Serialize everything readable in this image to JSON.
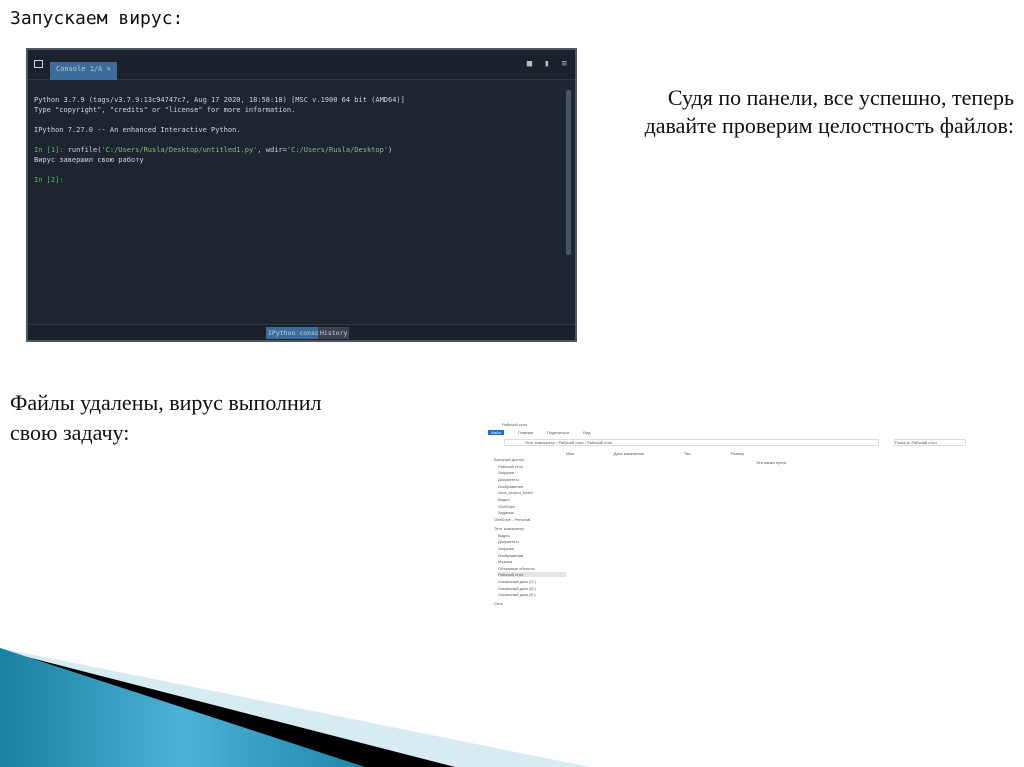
{
  "slide": {
    "title": "Запускаем вирус:",
    "right_text": [
      "Судя по панели, все успешно, теперь",
      "давайте проверим целостность файлов:"
    ],
    "left_text": [
      "Файлы удалены, вирус выполнил",
      "свою задачу:"
    ]
  },
  "console": {
    "tab": "Console 1/A ×",
    "lines": [
      "Python 3.7.9 (tags/v3.7.9:13c94747c7, Aug 17 2020, 18:58:18) [MSC v.1900 64 bit (AMD64)]",
      "Type \"copyright\", \"credits\" or \"license\" for more information.",
      "",
      "IPython 7.27.0 -- An enhanced Interactive Python."
    ],
    "prompt1": "In [1]: ",
    "cmd_pre": "runfile(",
    "cmd_path1": "'C:/Users/Rusla/Desktop/untitled1.py'",
    "cmd_mid": ", wdir=",
    "cmd_path2": "'C:/Users/Rusla/Desktop'",
    "cmd_end": ")",
    "output": "Вирус завершил свою работу",
    "prompt2": "In [2]:",
    "bottom_tabs": [
      "IPython console",
      "History"
    ]
  },
  "explorer": {
    "title": "Рабочий стол",
    "ribbon": [
      "Файл",
      "Главная",
      "Поделиться",
      "Вид"
    ],
    "address": "Этот компьютер › Рабочий стол › Рабочий стол",
    "search": "Поиск в: Рабочий стол",
    "columns": [
      "Имя",
      "Дата изменения",
      "Тип",
      "Размер"
    ],
    "empty": "Эта папка пуста.",
    "nav": [
      "Быстрый доступ",
      "Рабочий стол",
      "Загрузки",
      "Документы",
      "Изображения",
      "virus_project_folder",
      "Видео",
      "OneDrive",
      "Задания",
      "OneDrive - Personal",
      "Этот компьютер",
      "Видео",
      "Документы",
      "Загрузки",
      "Изображения",
      "Музыка",
      "Объемные объекты",
      "Рабочий стол",
      "Локальный диск (C:)",
      "Локальный диск (D:)",
      "Локальный диск (E:)",
      "Сеть"
    ]
  }
}
